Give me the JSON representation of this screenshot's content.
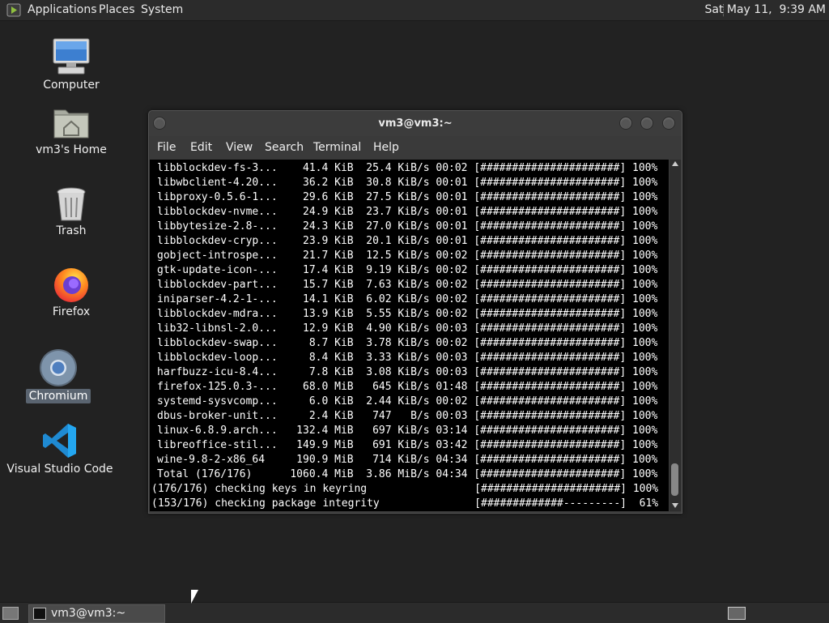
{
  "top_panel": {
    "menus": [
      "Applications",
      "Places",
      "System"
    ],
    "clock": "Sat May 11,  9:39 AM"
  },
  "desktop_icons": [
    {
      "name": "computer",
      "label": "Computer",
      "icon": "computer-icon"
    },
    {
      "name": "home",
      "label": "vm3's Home",
      "icon": "home-folder-icon"
    },
    {
      "name": "trash",
      "label": "Trash",
      "icon": "trash-icon"
    },
    {
      "name": "firefox",
      "label": "Firefox",
      "icon": "firefox-icon"
    },
    {
      "name": "chromium",
      "label": "Chromium",
      "icon": "chromium-icon",
      "selected": true
    },
    {
      "name": "vscode",
      "label": "Visual Studio Code",
      "icon": "vscode-icon"
    }
  ],
  "terminal": {
    "title": "vm3@vm3:~",
    "menu": [
      "File",
      "Edit",
      "View",
      "Search",
      "Terminal",
      "Help"
    ],
    "lines": [
      "libblockdev-fs-3...    41.4 KiB  25.4 KiB/s 00:02 [######################] 100%",
      "libwbclient-4.20...    36.2 KiB  30.8 KiB/s 00:01 [######################] 100%",
      "libproxy-0.5.6-1...    29.6 KiB  27.5 KiB/s 00:01 [######################] 100%",
      "libblockdev-nvme...    24.9 KiB  23.7 KiB/s 00:01 [######################] 100%",
      "libbytesize-2.8-...    24.3 KiB  27.0 KiB/s 00:01 [######################] 100%",
      "libblockdev-cryp...    23.9 KiB  20.1 KiB/s 00:01 [######################] 100%",
      "gobject-introspe...    21.7 KiB  12.5 KiB/s 00:02 [######################] 100%",
      "gtk-update-icon-...    17.4 KiB  9.19 KiB/s 00:02 [######################] 100%",
      "libblockdev-part...    15.7 KiB  7.63 KiB/s 00:02 [######################] 100%",
      "iniparser-4.2-1-...    14.1 KiB  6.02 KiB/s 00:02 [######################] 100%",
      "libblockdev-mdra...    13.9 KiB  5.55 KiB/s 00:02 [######################] 100%",
      "lib32-libnsl-2.0...    12.9 KiB  4.90 KiB/s 00:03 [######################] 100%",
      "libblockdev-swap...     8.7 KiB  3.78 KiB/s 00:02 [######################] 100%",
      "libblockdev-loop...     8.4 KiB  3.33 KiB/s 00:03 [######################] 100%",
      "harfbuzz-icu-8.4...     7.8 KiB  3.08 KiB/s 00:03 [######################] 100%",
      "firefox-125.0.3-...    68.0 MiB   645 KiB/s 01:48 [######################] 100%",
      "systemd-sysvcomp...     6.0 KiB  2.44 KiB/s 00:02 [######################] 100%",
      "dbus-broker-unit...     2.4 KiB   747   B/s 00:03 [######################] 100%",
      "linux-6.8.9.arch...   132.4 MiB   697 KiB/s 03:14 [######################] 100%",
      "libreoffice-stil...   149.9 MiB   691 KiB/s 03:42 [######################] 100%",
      "wine-9.8-2-x86_64     190.9 MiB   714 KiB/s 04:34 [######################] 100%",
      "Total (176/176)      1060.4 MiB  3.86 MiB/s 04:34 [######################] 100%",
      "(176/176) checking keys in keyring                 [######################] 100%",
      "(153/176) checking package integrity               [#############---------]  61%"
    ]
  },
  "taskbar": {
    "task_label": "vm3@vm3:~"
  },
  "colors": {
    "desktop_bg": "#222222",
    "panel_bg": "#2b2b2b",
    "terminal_bg": "#000000",
    "terminal_fg": "#ffffff",
    "selection_bg": "#5a6470"
  }
}
